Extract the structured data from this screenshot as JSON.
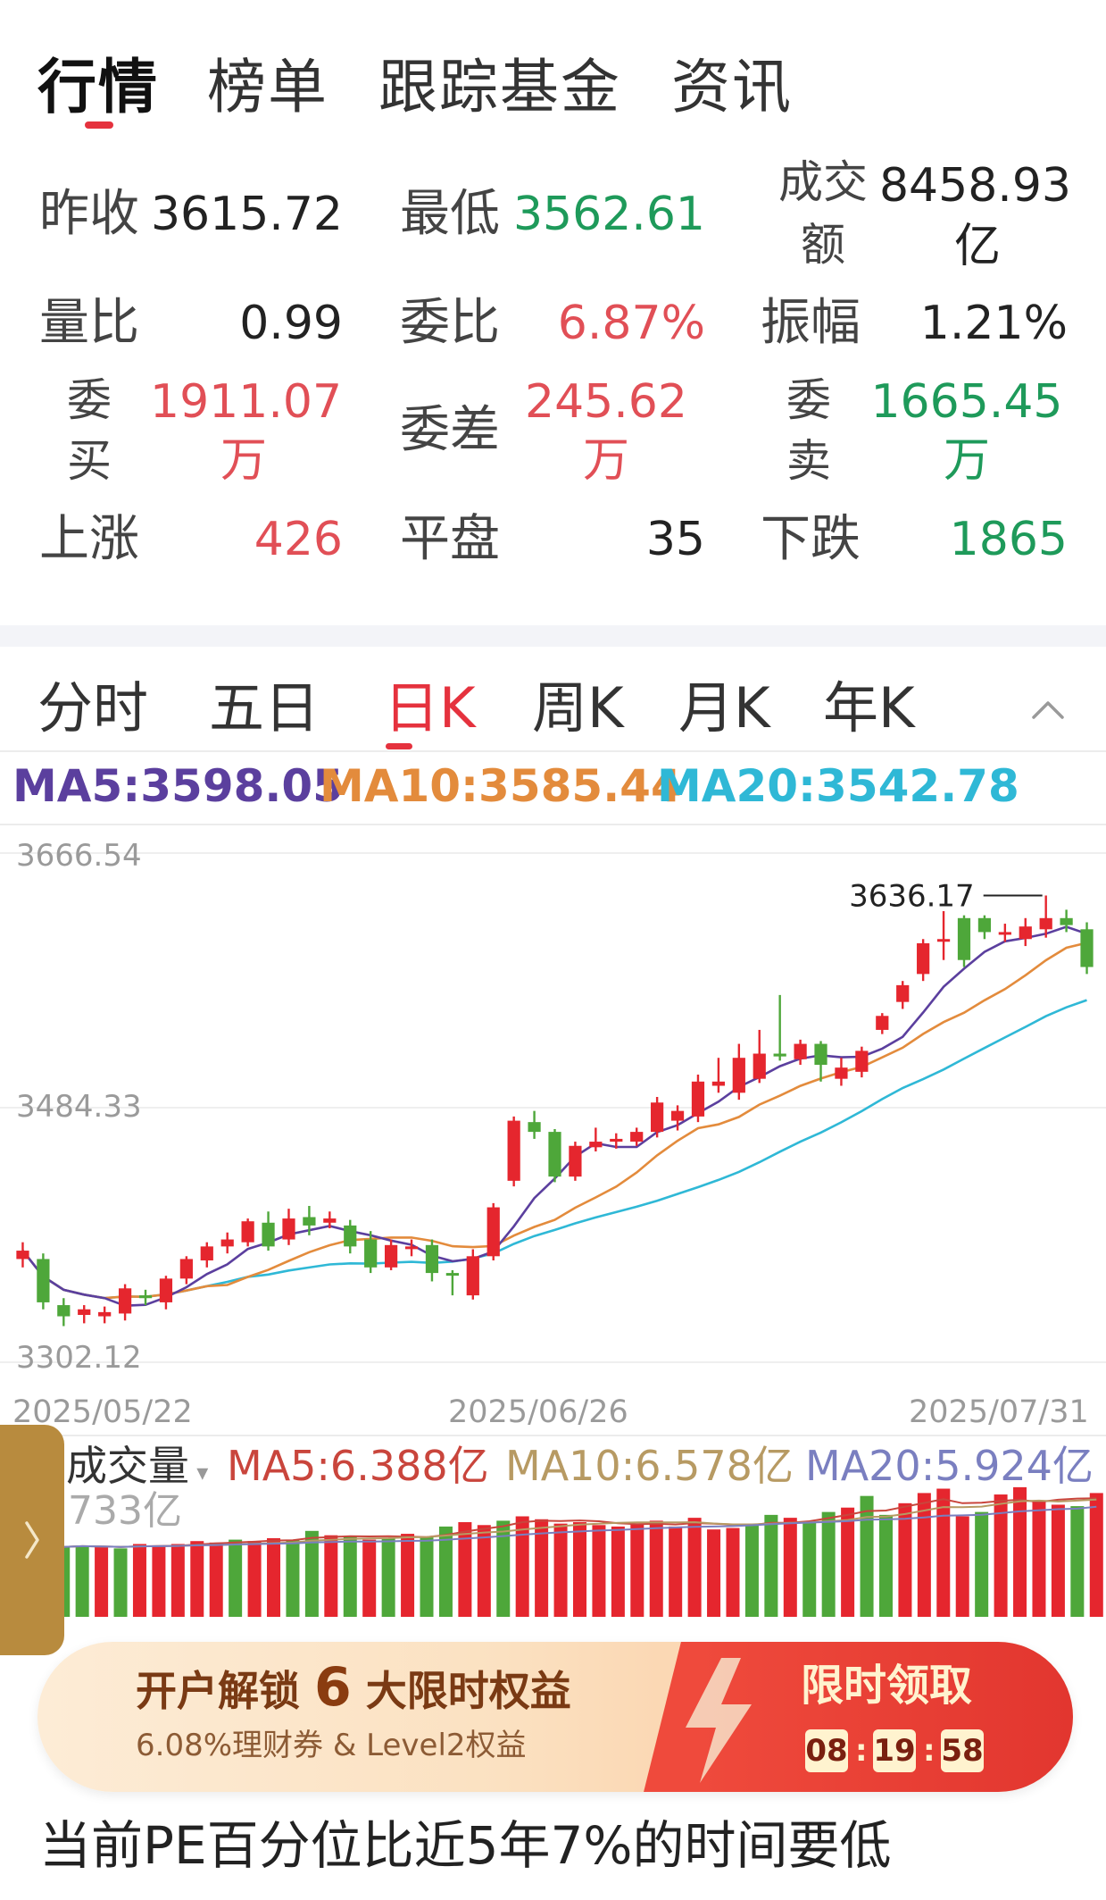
{
  "top_tabs": [
    "行情",
    "榜单",
    "跟踪基金",
    "资讯"
  ],
  "quote": {
    "prev_close_label": "昨收",
    "prev_close": "3615.72",
    "low_label": "最低",
    "low": "3562.61",
    "turnover_label_1": "成交",
    "turnover_label_2": "额",
    "turnover_value": "8458.93",
    "turnover_unit": "亿",
    "volume_ratio_label": "量比",
    "volume_ratio": "0.99",
    "commission_ratio_label": "委比",
    "commission_ratio": "6.87%",
    "amplitude_label": "振幅",
    "amplitude": "1.21%",
    "bid_label_1": "委",
    "bid_label_2": "买",
    "bid_value": "1911.07",
    "bid_unit": "万",
    "diff_label": "委差",
    "diff_value": "245.62",
    "diff_unit": "万",
    "ask_label_1": "委",
    "ask_label_2": "卖",
    "ask_value": "1665.45",
    "ask_unit": "万",
    "up_label": "上涨",
    "up_count": "426",
    "flat_label": "平盘",
    "flat_count": "35",
    "down_label": "下跌",
    "down_count": "1865"
  },
  "chart_tabs": [
    "分时",
    "五日",
    "日K",
    "周K",
    "月K",
    "年K"
  ],
  "ma": {
    "ma5": "MA5:3598.05",
    "ma10": "MA10:3585.44",
    "ma20": "MA20:3542.78"
  },
  "colors": {
    "ma5": "#5b3f9e",
    "ma10": "#e38b3c",
    "ma20": "#2fb8d6",
    "up": "#e5262e",
    "down": "#4ea73a",
    "accent": "#e5323e"
  },
  "price_axis": {
    "top": "3666.54",
    "mid": "3484.33",
    "bottom": "3302.12",
    "high_marker": "3636.17"
  },
  "date_axis": [
    "2025/05/22",
    "2025/06/26",
    "2025/07/31"
  ],
  "volume": {
    "label": "成交量",
    "partial_value": "733亿",
    "ma5": "MA5:6.388亿",
    "ma10": "MA10:6.578亿",
    "ma20": "MA20:5.924亿"
  },
  "banner": {
    "title_prefix": "开户解锁",
    "title_number": "6",
    "title_suffix": "大限时权益",
    "subtitle": "6.08%理财券 & Level2权益",
    "cta": "限时领取",
    "timer": [
      "08",
      "19",
      "58"
    ]
  },
  "footer_text": "当前PE百分位比近5年7%的时间要低",
  "chart_data": {
    "type": "candlestick",
    "xlabel": "",
    "ylabel": "",
    "x_ticks": [
      "2025/05/22",
      "2025/06/26",
      "2025/07/31"
    ],
    "ylim": [
      3302.12,
      3666.54
    ],
    "high_annotation": 3636.17,
    "series": [
      {
        "name": "MA5",
        "last": 3598.05
      },
      {
        "name": "MA10",
        "last": 3585.44
      },
      {
        "name": "MA20",
        "last": 3542.78
      }
    ],
    "candles": [
      [
        3376,
        3382,
        3388,
        3370
      ],
      [
        3376,
        3345,
        3380,
        3340
      ],
      [
        3343,
        3335,
        3348,
        3328
      ],
      [
        3336,
        3340,
        3343,
        3330
      ],
      [
        3335,
        3338,
        3342,
        3330
      ],
      [
        3337,
        3355,
        3358,
        3332
      ],
      [
        3350,
        3348,
        3354,
        3343
      ],
      [
        3345,
        3362,
        3364,
        3340
      ],
      [
        3362,
        3376,
        3378,
        3358
      ],
      [
        3375,
        3385,
        3388,
        3370
      ],
      [
        3385,
        3390,
        3395,
        3380
      ],
      [
        3388,
        3403,
        3405,
        3385
      ],
      [
        3402,
        3385,
        3410,
        3382
      ],
      [
        3390,
        3405,
        3412,
        3386
      ],
      [
        3406,
        3400,
        3414,
        3393
      ],
      [
        3402,
        3405,
        3410,
        3398
      ],
      [
        3400,
        3385,
        3404,
        3380
      ],
      [
        3390,
        3370,
        3396,
        3366
      ],
      [
        3370,
        3386,
        3390,
        3368
      ],
      [
        3384,
        3385,
        3390,
        3378
      ],
      [
        3386,
        3366,
        3390,
        3360
      ],
      [
        3366,
        3365,
        3368,
        3350
      ],
      [
        3350,
        3378,
        3383,
        3347
      ],
      [
        3378,
        3413,
        3416,
        3375
      ],
      [
        3432,
        3475,
        3478,
        3428
      ],
      [
        3474,
        3467,
        3482,
        3462
      ],
      [
        3467,
        3435,
        3469,
        3431
      ],
      [
        3435,
        3457,
        3460,
        3432
      ],
      [
        3456,
        3460,
        3470,
        3453
      ],
      [
        3460,
        3462,
        3466,
        3455
      ],
      [
        3460,
        3467,
        3470,
        3457
      ],
      [
        3467,
        3488,
        3492,
        3463
      ],
      [
        3475,
        3482,
        3486,
        3468
      ],
      [
        3478,
        3503,
        3508,
        3474
      ],
      [
        3500,
        3503,
        3520,
        3495
      ],
      [
        3495,
        3520,
        3530,
        3490
      ],
      [
        3505,
        3523,
        3540,
        3502
      ],
      [
        3523,
        3521,
        3565,
        3518
      ],
      [
        3519,
        3530,
        3533,
        3515
      ],
      [
        3530,
        3515,
        3532,
        3503
      ],
      [
        3505,
        3513,
        3520,
        3500
      ],
      [
        3510,
        3525,
        3528,
        3506
      ],
      [
        3540,
        3550,
        3552,
        3537
      ],
      [
        3560,
        3572,
        3575,
        3555
      ],
      [
        3580,
        3602,
        3605,
        3575
      ],
      [
        3605,
        3605,
        3625,
        3590
      ],
      [
        3620,
        3590,
        3622,
        3585
      ],
      [
        3620,
        3610,
        3622,
        3605
      ],
      [
        3610,
        3610,
        3616,
        3603
      ],
      [
        3605,
        3614,
        3620,
        3600
      ],
      [
        3612,
        3620,
        3636.17,
        3606
      ],
      [
        3620,
        3615,
        3626,
        3610
      ],
      [
        3612,
        3585,
        3617,
        3580
      ]
    ],
    "volume": {
      "unit": "亿",
      "bars": [
        [
          4.8,
          0
        ],
        [
          4.9,
          0
        ],
        [
          4.8,
          1
        ],
        [
          4.7,
          0
        ],
        [
          5.0,
          1
        ],
        [
          4.9,
          1
        ],
        [
          5.0,
          1
        ],
        [
          5.2,
          1
        ],
        [
          5.1,
          1
        ],
        [
          5.3,
          0
        ],
        [
          5.2,
          1
        ],
        [
          5.4,
          1
        ],
        [
          5.3,
          0
        ],
        [
          5.9,
          0
        ],
        [
          5.6,
          1
        ],
        [
          5.5,
          0
        ],
        [
          5.3,
          1
        ],
        [
          5.4,
          0
        ],
        [
          5.7,
          1
        ],
        [
          5.5,
          0
        ],
        [
          6.2,
          0
        ],
        [
          6.5,
          1
        ],
        [
          6.3,
          1
        ],
        [
          6.6,
          0
        ],
        [
          6.9,
          1
        ],
        [
          6.7,
          1
        ],
        [
          6.4,
          1
        ],
        [
          6.5,
          1
        ],
        [
          6.3,
          1
        ],
        [
          6.2,
          1
        ],
        [
          6.4,
          1
        ],
        [
          6.6,
          1
        ],
        [
          6.2,
          1
        ],
        [
          6.8,
          1
        ],
        [
          6.0,
          1
        ],
        [
          6.1,
          1
        ],
        [
          6.4,
          0
        ],
        [
          7.0,
          0
        ],
        [
          6.8,
          1
        ],
        [
          6.5,
          0
        ],
        [
          7.2,
          0
        ],
        [
          7.5,
          1
        ],
        [
          8.3,
          0
        ],
        [
          7.0,
          0
        ],
        [
          7.8,
          1
        ],
        [
          8.5,
          1
        ],
        [
          8.8,
          1
        ],
        [
          6.9,
          1
        ],
        [
          7.2,
          0
        ],
        [
          8.4,
          1
        ],
        [
          8.9,
          1
        ],
        [
          8.0,
          1
        ],
        [
          7.7,
          1
        ],
        [
          7.6,
          0
        ],
        [
          8.5,
          1
        ]
      ]
    }
  }
}
